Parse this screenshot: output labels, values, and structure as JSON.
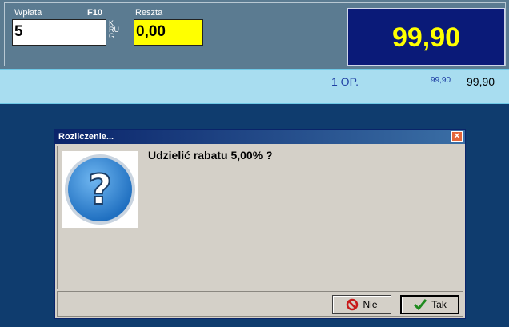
{
  "header": {
    "payment_label": "Wpłata",
    "payment_shortcut": "F10",
    "payment_value": "5",
    "krug_letters": [
      "K",
      "RU",
      "G"
    ],
    "change_label": "Reszta",
    "change_value": "0,00",
    "total_value": "99,90"
  },
  "line": {
    "qty_label": "1 OP.",
    "unit_price": "99,90",
    "line_total": "99,90"
  },
  "dialog": {
    "title": "Rozliczenie...",
    "close_symbol": "✕",
    "message": "Udzielić rabatu 5,00% ?",
    "buttons": {
      "no_label": "Nie",
      "yes_label": "Tak"
    }
  },
  "colors": {
    "total_text": "#ffff00",
    "total_bg": "#0a1a78",
    "change_bg": "#ffff00",
    "background": "#0f3c6e"
  }
}
